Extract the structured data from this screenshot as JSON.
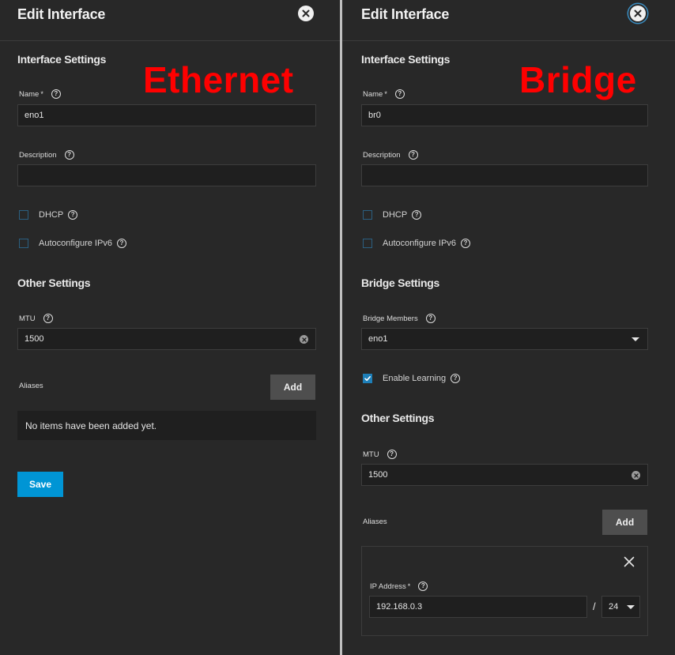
{
  "left": {
    "overlay_label": "Ethernet",
    "title": "Edit Interface",
    "interface_settings": "Interface Settings",
    "name_label": "Name",
    "name_required": "*",
    "name_value": "eno1",
    "description_label": "Description",
    "description_value": "",
    "dhcp_label": "DHCP",
    "ipv6_label": "Autoconfigure IPv6",
    "other_settings": "Other Settings",
    "mtu_label": "MTU",
    "mtu_value": "1500",
    "aliases_label": "Aliases",
    "add_label": "Add",
    "empty_text": "No items have been added yet.",
    "save_label": "Save"
  },
  "right": {
    "overlay_label": "Bridge",
    "title": "Edit Interface",
    "interface_settings": "Interface Settings",
    "name_label": "Name",
    "name_required": "*",
    "name_value": "br0",
    "description_label": "Description",
    "description_value": "",
    "dhcp_label": "DHCP",
    "ipv6_label": "Autoconfigure IPv6",
    "bridge_settings": "Bridge Settings",
    "bridge_members_label": "Bridge Members",
    "bridge_members_value": "eno1",
    "enable_learning_label": "Enable Learning",
    "enable_learning_checked": true,
    "other_settings": "Other Settings",
    "mtu_label": "MTU",
    "mtu_value": "1500",
    "aliases_label": "Aliases",
    "add_label": "Add",
    "ip_address_label": "IP Address",
    "ip_required": "*",
    "ip_value": "192.168.0.3",
    "slash": "/",
    "netmask_value": "24"
  },
  "colors": {
    "background": "#282828",
    "input_bg": "#1f1f1f",
    "save_button": "#0095d5",
    "add_button": "#4e4e4e",
    "checkbox_checked": "#1e7fb8",
    "overlay_text": "#ff0000"
  },
  "icons": {
    "close": "close-icon",
    "help": "help-icon",
    "clear": "clear-icon",
    "dropdown": "chevron-down-icon",
    "remove_alias": "x-icon",
    "check": "check-icon"
  }
}
